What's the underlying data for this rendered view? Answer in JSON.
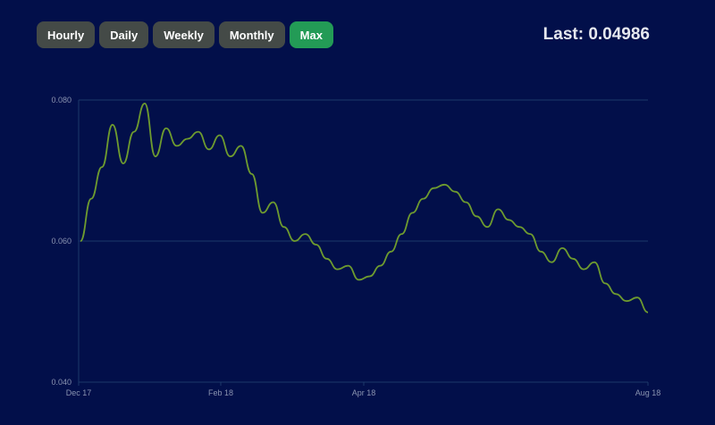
{
  "toolbar": {
    "buttons": [
      {
        "label": "Hourly",
        "active": false
      },
      {
        "label": "Daily",
        "active": false
      },
      {
        "label": "Weekly",
        "active": false
      },
      {
        "label": "Monthly",
        "active": false
      },
      {
        "label": "Max",
        "active": true
      }
    ]
  },
  "header": {
    "last_label": "Last: 0.04986"
  },
  "colors": {
    "background": "#020f4a",
    "line": "#6e9b2f",
    "grid": "#1c3a6a",
    "active_button": "#239b56",
    "button": "#444a47"
  },
  "chart_data": {
    "type": "line",
    "title": "",
    "xlabel": "",
    "ylabel": "",
    "ylim": [
      0.04,
      0.08
    ],
    "y_ticks": [
      "0.040",
      "0.060",
      "0.080"
    ],
    "x_ticks": [
      "Dec 17",
      "Feb 18",
      "Apr 18",
      "Aug 18"
    ],
    "grid": true,
    "series": [
      {
        "values": [
          0.06,
          0.066,
          0.0705,
          0.0765,
          0.071,
          0.0755,
          0.0795,
          0.072,
          0.076,
          0.0735,
          0.0745,
          0.0755,
          0.073,
          0.075,
          0.072,
          0.0735,
          0.0695,
          0.064,
          0.0655,
          0.062,
          0.06,
          0.061,
          0.0595,
          0.0575,
          0.056,
          0.0565,
          0.0545,
          0.055,
          0.0565,
          0.0585,
          0.061,
          0.064,
          0.066,
          0.0675,
          0.068,
          0.067,
          0.0655,
          0.0635,
          0.062,
          0.0645,
          0.063,
          0.062,
          0.061,
          0.0585,
          0.057,
          0.059,
          0.0575,
          0.056,
          0.057,
          0.054,
          0.0525,
          0.0515,
          0.052,
          0.0499
        ]
      }
    ]
  }
}
